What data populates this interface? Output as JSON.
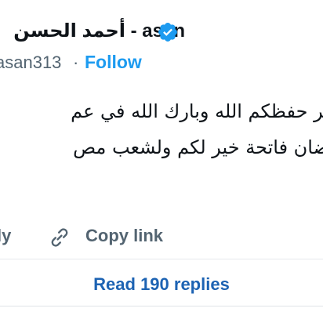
{
  "header": {
    "author_name": "أحمد الحسن - asan",
    "handle": "asan313",
    "separator": "·",
    "follow_label": "Follow"
  },
  "tweet": {
    "line1": "ير حفظكم الله وبارك الله في عم",
    "line2": "ضان فاتحة خير لكم ولشعب مص"
  },
  "actions": {
    "reply_label": "ly",
    "copy_link_label": "Copy link",
    "read_replies_label": "Read 190 replies"
  },
  "icons": {
    "verified": "verified-badge-icon",
    "copy_link": "link-icon"
  },
  "colors": {
    "accent": "#1d9bf0",
    "text": "#0f1419",
    "secondary": "#536471",
    "replies_link": "#1d63b3"
  }
}
